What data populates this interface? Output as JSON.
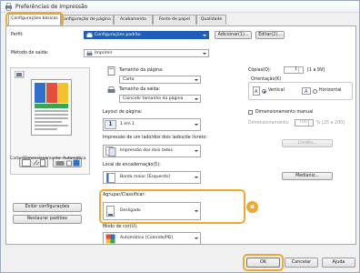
{
  "window": {
    "title": "Preferências de Impressão"
  },
  "tabs": [
    {
      "label": "Configurações básicas"
    },
    {
      "label": "onfiguração de página"
    },
    {
      "label": "Acabamento"
    },
    {
      "label": "Fonte de papel"
    },
    {
      "label": "Qualidade"
    }
  ],
  "profile": {
    "label": "Perfil:",
    "value": "Configurações padrão",
    "add_button": "Adicionar(1)...",
    "edit_button": "Editar(2)..."
  },
  "output_method": {
    "label": "Método de saída:",
    "value": "Imprimir"
  },
  "preview": {
    "caption": "Carta [Dimensionamento: Automático"
  },
  "page_size": {
    "label": "Tamanho da página:",
    "value": "Carta"
  },
  "output_size": {
    "label": "Tamanho da saída:",
    "value": "Coincidir tamanho da página"
  },
  "layout": {
    "label": "Layout de página:",
    "value": "1 em 1",
    "icon_digit": "1"
  },
  "print_sides": {
    "label": "Impressão de um lado/dos dois lados/de livreto:",
    "value": "Impressão dos dois lados"
  },
  "binding": {
    "label": "Local de encadernação(5):",
    "value": "Borda maior [Esquerda]",
    "margin_button": "Medianiz..."
  },
  "collate": {
    "label": "Agrupar/Classificar:",
    "value": "Desligado"
  },
  "color_mode": {
    "label": "Modo de cor(U):",
    "value": "Automático [Colorido/PB]"
  },
  "copies": {
    "label": "Cópias(Q):",
    "value": "1",
    "range": "[1 a 99]"
  },
  "orientation": {
    "label": "Orientação(K)",
    "portrait": "Vertical",
    "landscape": "Horizontal",
    "selected": "Vertical"
  },
  "scaling": {
    "label": "Dimensionamento manual",
    "sub_label": "Dimensionamento:",
    "value": "100",
    "range": "% [25 a 200]"
  },
  "booklet_button": "Livreto...",
  "view_settings_button": "Exibir configurações",
  "restore_defaults_button": "Restaurar padrões",
  "callout_letter": "a",
  "footer": {
    "ok": "OK",
    "cancel": "Cancelar",
    "help": "Ajuda"
  },
  "colors": {
    "accent": "#f0a830",
    "selection": "#1f5fb8"
  }
}
